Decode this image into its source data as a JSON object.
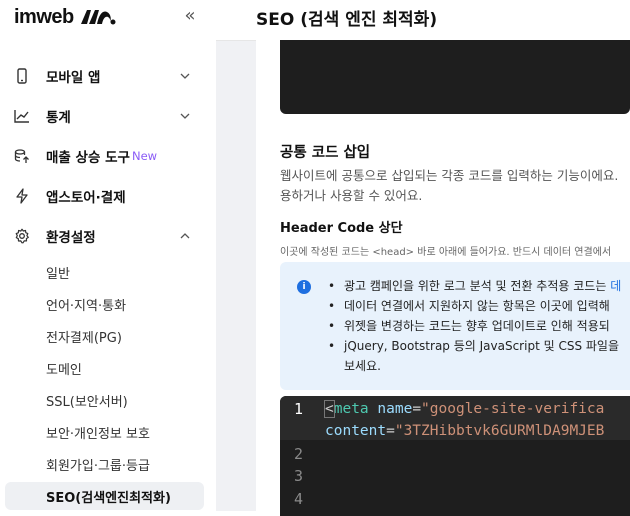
{
  "brand": {
    "logo_text": "imweb"
  },
  "sidebar": {
    "collapse_glyph": "«",
    "items": [
      {
        "label": "모바일 앱",
        "icon": "mobile-icon",
        "chevron": "down"
      },
      {
        "label": "통계",
        "icon": "chart-line-icon",
        "chevron": "down"
      },
      {
        "label": "매출 상승 도구",
        "icon": "coins-up-icon",
        "badge": "New"
      },
      {
        "label": "앱스토어·결제",
        "icon": "lightning-icon"
      },
      {
        "label": "환경설정",
        "icon": "gear-icon",
        "chevron": "up"
      }
    ],
    "settings_sub": [
      "일반",
      "언어·지역·통화",
      "전자결제(PG)",
      "도메인",
      "SSL(보안서버)",
      "보안·개인정보 보호",
      "회원가입·그룹·등급",
      "SEO(검색엔진최적화)"
    ],
    "active_sub": "SEO(검색엔진최적화)"
  },
  "header": {
    "title": "SEO (검색 엔진 최적화)"
  },
  "content": {
    "section_title": "공통 코드 삽입",
    "section_desc_1": "웹사이트에 공통으로 삽입되는 각종 코드를 입력하는 기능이에요.",
    "section_desc_2": "용하거나 사용할 수 있어요.",
    "header_code_title": "Header Code 상단",
    "header_code_desc": "이곳에 작성된 코드는 <head> 바로 아래에 들어가요. 반드시 데이터 연결에서",
    "info_items": [
      "광고 캠페인을 위한 로그 분석 및 전환 추적용 코드는",
      "데이터 연결에서 지원하지 않는 항목은 이곳에 입력해",
      "위젯을 변경하는 코드는 향후 업데이트로 인해 적용되",
      "jQuery, Bootstrap 등의 JavaScript 및 CSS 파일을"
    ],
    "info_item_1_link": "데",
    "info_item_4_cont": "보세요.",
    "code": {
      "line_numbers": [
        "1",
        "2",
        "3",
        "4"
      ],
      "line1": {
        "lt": "<",
        "tag": "meta",
        "attr": "name",
        "eq": "=",
        "value": "\"google-site-verifica"
      },
      "line1b": {
        "attr": "content",
        "eq": "=",
        "value": "\"3TZHibbtvk6GURMlDA9MJEB"
      }
    }
  },
  "colors": {
    "accent": "#1e6fe0",
    "new_badge": "#8b5cf6",
    "code_bg": "#1e1e1e",
    "info_bg": "#e8f2fc"
  }
}
